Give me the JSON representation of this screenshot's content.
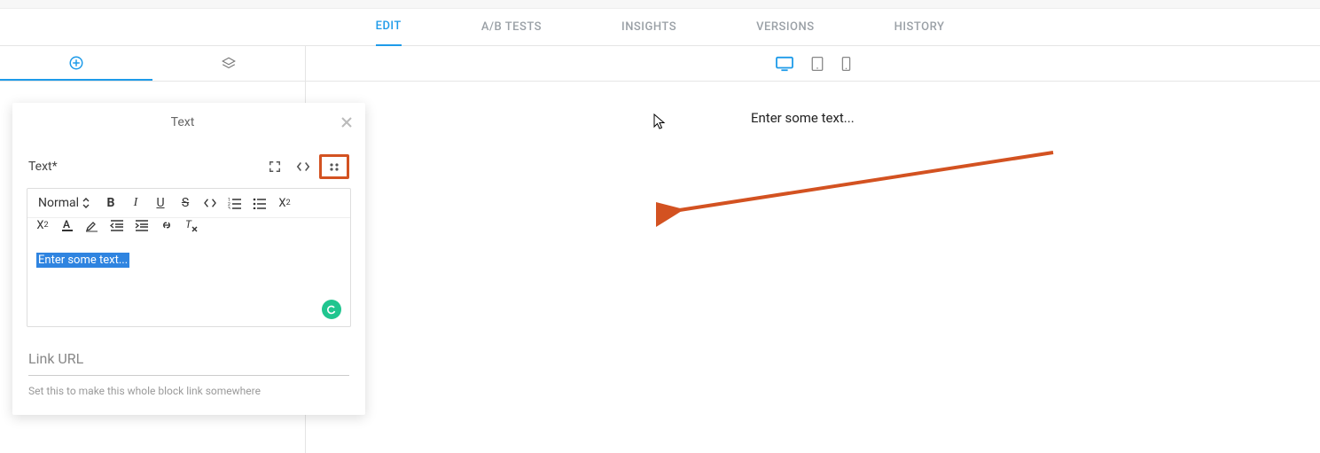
{
  "maintabs": {
    "edit": "EDIT",
    "abtests": "A/B TESTS",
    "insights": "INSIGHTS",
    "versions": "VERSIONS",
    "history": "HISTORY"
  },
  "canvas": {
    "placeholder": "Enter some text..."
  },
  "panel": {
    "title": "Text",
    "field_label": "Text*",
    "format_select": "Normal",
    "editor_text": "Enter some text...",
    "linkurl_label": "Link URL",
    "linkurl_help": "Set this to make this whole block link somewhere"
  },
  "colors": {
    "accent": "#1e9be9",
    "annotation": "#d35221"
  }
}
